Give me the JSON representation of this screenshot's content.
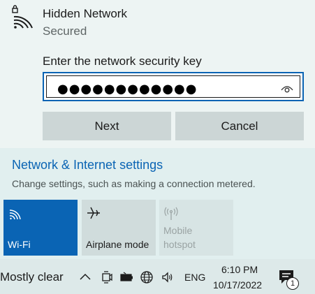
{
  "network": {
    "name": "Hidden Network",
    "status": "Secured",
    "icon": "wifi-secured-icon"
  },
  "security_key": {
    "label": "Enter the network security key",
    "masked_value": "●●●●●●●●●●●●",
    "reveal_icon": "eye-icon"
  },
  "buttons": {
    "next": "Next",
    "cancel": "Cancel"
  },
  "settings": {
    "link": "Network & Internet settings",
    "description": "Change settings, such as making a connection metered."
  },
  "quick_actions": [
    {
      "label": "Wi-Fi",
      "icon": "wifi-icon",
      "state": "on"
    },
    {
      "label": "Airplane mode",
      "icon": "airplane-icon",
      "state": "off"
    },
    {
      "label": "Mobile hotspot",
      "icon": "hotspot-icon",
      "state": "disabled"
    }
  ],
  "taskbar": {
    "weather": "Mostly clear",
    "language": "ENG",
    "time": "6:10 PM",
    "date": "10/17/2022",
    "notification_count": "1",
    "tray_icons": [
      "chevron-up-icon",
      "meet-now-icon",
      "battery-icon",
      "globe-network-icon",
      "volume-icon"
    ]
  },
  "colors": {
    "accent": "#0a64b4",
    "panel": "#edf4f3",
    "settings_bg": "#e1efef",
    "button": "#ccd6d6"
  }
}
